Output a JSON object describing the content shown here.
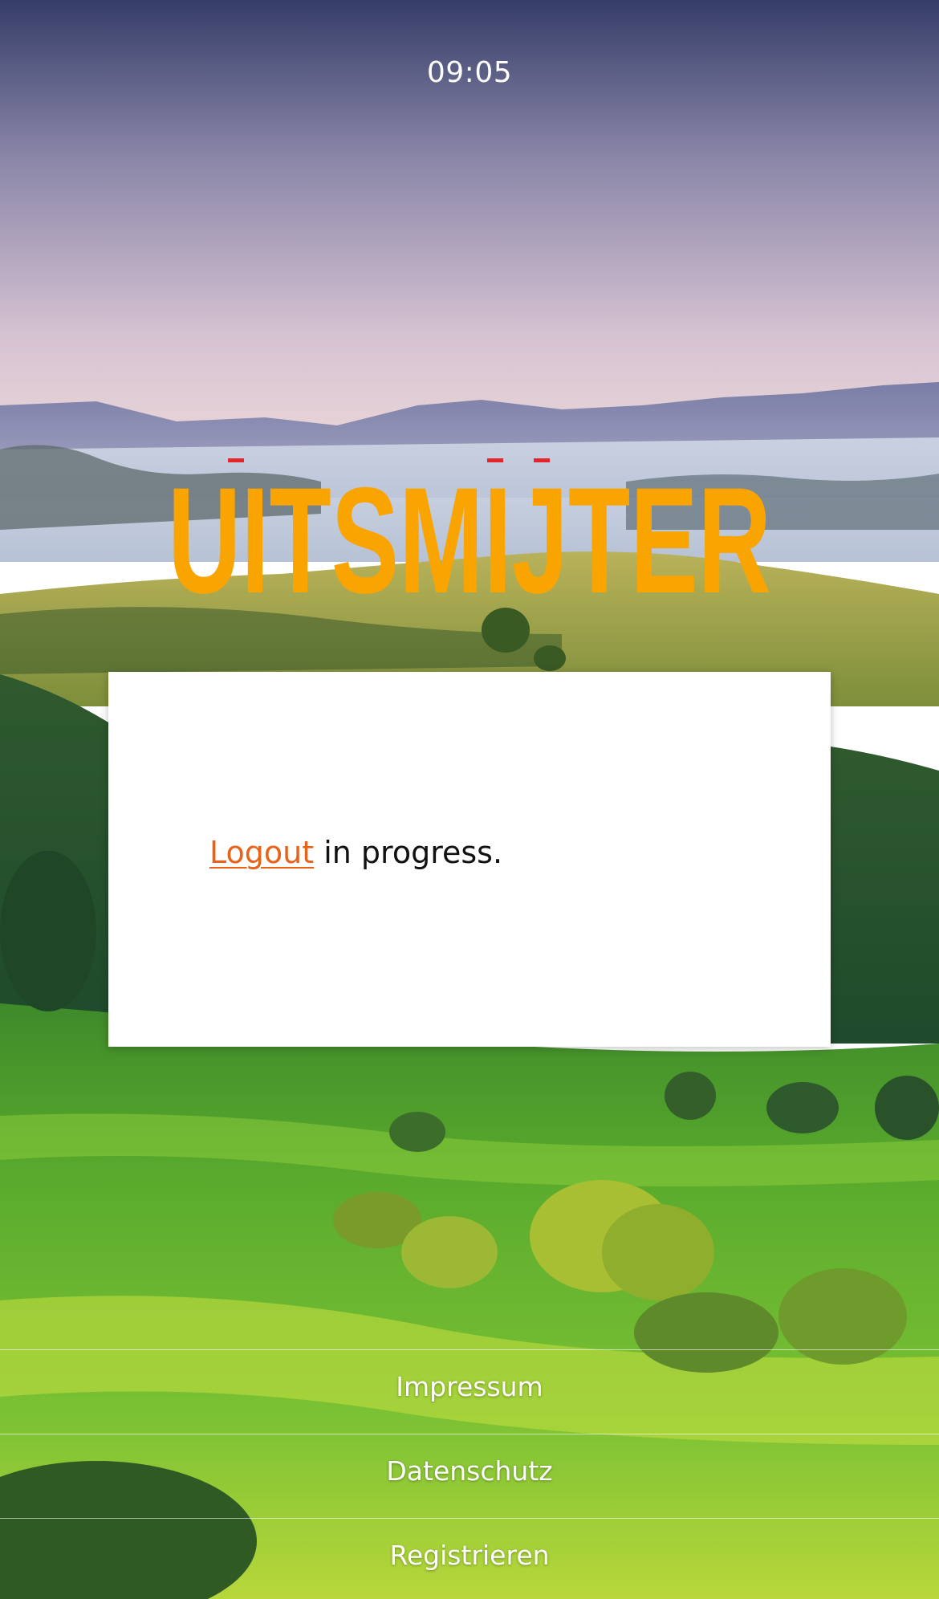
{
  "status": {
    "time": "09:05"
  },
  "brand": {
    "name": "UITSMIJTER",
    "color": "#f9a400",
    "accent_color": "#e4262c"
  },
  "card": {
    "link_text": "Logout",
    "message_rest": " in progress.",
    "link_color": "#e8621a"
  },
  "footer": {
    "links": [
      {
        "label": "Impressum"
      },
      {
        "label": "Datenschutz"
      },
      {
        "label": "Registrieren"
      }
    ]
  },
  "background": {
    "icon": "landscape-hills-photo",
    "sky_top": "#353d68",
    "sky_bottom": "#e2ccd6",
    "grass": "#62b62e"
  }
}
